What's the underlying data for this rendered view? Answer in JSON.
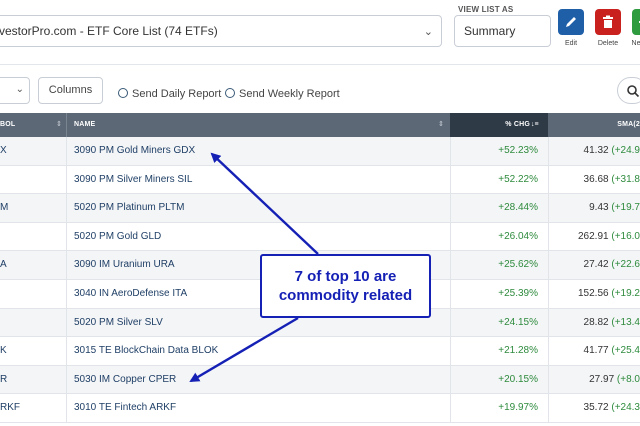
{
  "header": {
    "list_name": "vestorPro.com - ETF Core List (74 ETFs)",
    "view_list_label": "VIEW LIST AS",
    "view_value": "Summary",
    "actions": [
      {
        "label": "Edit",
        "icon": "pencil-icon",
        "color": "#1f5fa8"
      },
      {
        "label": "Delete",
        "icon": "trash-icon",
        "color": "#c9211e"
      },
      {
        "label": "Ne",
        "icon": "plus-icon",
        "color": "#2e9b3e"
      }
    ]
  },
  "toolbar": {
    "columns_label": "Columns",
    "send_daily": "Send Daily Report",
    "send_weekly": "Send Weekly Report"
  },
  "table": {
    "headers": {
      "symbol": "BOL",
      "name": "NAME",
      "chg": "% CHG",
      "sma": "SMA(2"
    },
    "rows": [
      {
        "symbol": "X",
        "name": "3090 PM Gold Miners GDX",
        "chg": "+52.23%",
        "sma": "41.32",
        "sma_chg": "(+24.9"
      },
      {
        "symbol": "",
        "name": "3090 PM Silver Miners SIL",
        "chg": "+52.22%",
        "sma": "36.68",
        "sma_chg": "(+31.8"
      },
      {
        "symbol": "M",
        "name": "5020 PM Platinum PLTM",
        "chg": "+28.44%",
        "sma": "9.43",
        "sma_chg": "(+19.7"
      },
      {
        "symbol": "",
        "name": "5020 PM Gold GLD",
        "chg": "+26.04%",
        "sma": "262.91",
        "sma_chg": "(+16.0"
      },
      {
        "symbol": "A",
        "name": "3090 IM Uranium URA",
        "chg": "+25.62%",
        "sma": "27.42",
        "sma_chg": "(+22.6"
      },
      {
        "symbol": "",
        "name": "3040 IN AeroDefense ITA",
        "chg": "+25.39%",
        "sma": "152.56",
        "sma_chg": "(+19.2"
      },
      {
        "symbol": "",
        "name": "5020 PM Silver SLV",
        "chg": "+24.15%",
        "sma": "28.82",
        "sma_chg": "(+13.4"
      },
      {
        "symbol": "K",
        "name": "3015 TE BlockChain Data BLOK",
        "chg": "+21.28%",
        "sma": "41.77",
        "sma_chg": "(+25.4"
      },
      {
        "symbol": "R",
        "name": "5030 IM Copper CPER",
        "chg": "+20.15%",
        "sma": "27.97",
        "sma_chg": "(+8.0"
      },
      {
        "symbol": "RKF",
        "name": "3010 TE Fintech ARKF",
        "chg": "+19.97%",
        "sma": "35.72",
        "sma_chg": "(+24.3"
      }
    ]
  },
  "annotation": {
    "line1": "7 of top 10 are",
    "line2": "commodity related",
    "color": "#1520b5"
  }
}
